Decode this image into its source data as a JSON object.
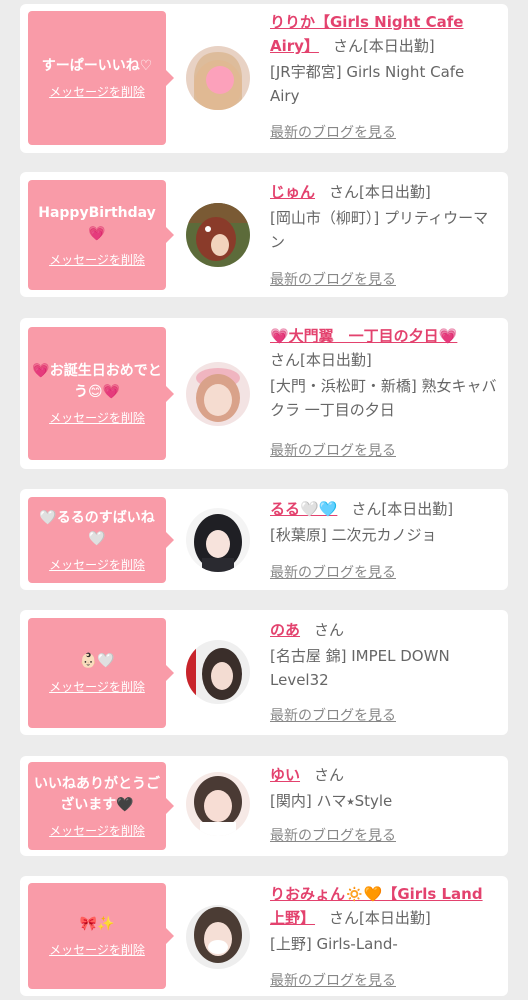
{
  "common": {
    "delete_label": "メッセージを削除",
    "blog_label": "最新のブログを見る",
    "san": "さん"
  },
  "cards": [
    {
      "message": "すーぱーいいね♡",
      "name": "りりか【Girls Night Cafe Airy】",
      "status": "[本日出勤]",
      "shop": "[JR宇都宮] Girls Night Cafe Airy"
    },
    {
      "message": "HappyBirthday💗",
      "name": "じゅん",
      "status": "[本日出勤]",
      "shop": "[岡山市（柳町）] プリティウーマン"
    },
    {
      "message": "💗お誕生日おめでとう😊💗",
      "name": "💗大門翼　一丁目の夕日💗",
      "status": "[本日出勤]",
      "shop": "[大門・浜松町・新橋] 熟女キャバクラ 一丁目の夕日"
    },
    {
      "message": "🤍るるのすばいね🤍",
      "name": "るる🤍🩵",
      "status": "[本日出勤]",
      "shop": "[秋葉原] 二次元カノジョ"
    },
    {
      "message": "👶🏻🤍",
      "name": "のあ",
      "status": "",
      "shop": "[名古屋 錦] IMPEL DOWN Level32"
    },
    {
      "message": "いいねありがとうございます🖤",
      "name": "ゆい",
      "status": "",
      "shop": "[関内] ハマ⭑Style"
    },
    {
      "message": "🎀✨",
      "name": "りおみょん🔅🧡【Girls Land 上野】",
      "status": "[本日出勤]",
      "shop": "[上野] Girls-Land-"
    }
  ],
  "colors": {
    "bubble": "#f99ba8",
    "name": "#e3426e",
    "card": "#ffffff",
    "background": "#ececec"
  }
}
